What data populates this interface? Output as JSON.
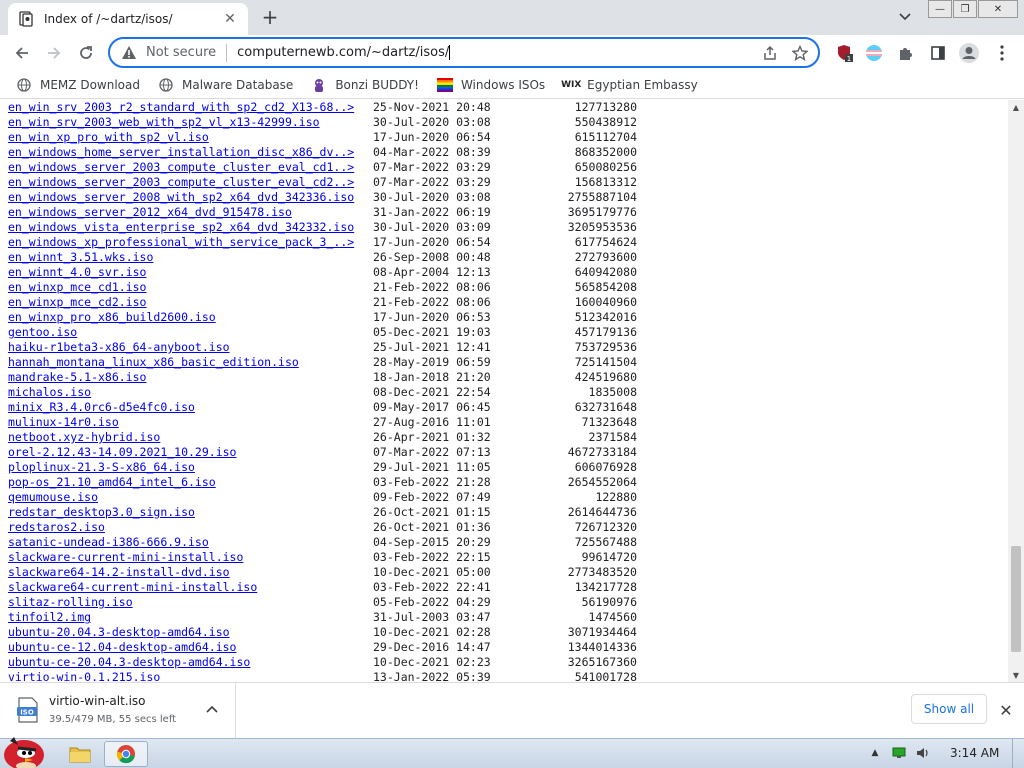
{
  "tab": {
    "title": "Index of /~dartz/isos/",
    "close": "✕"
  },
  "new_tab": "+",
  "window": {
    "minimize": "—",
    "maximize": "❐",
    "close": "✕"
  },
  "omnibox": {
    "security_label": "Not secure",
    "url": "computernewb.com/~dartz/isos/"
  },
  "extensions": {
    "badge": "1"
  },
  "bookmarks": [
    {
      "label": "MEMZ Download",
      "icon": "globe-icon"
    },
    {
      "label": "Malware Database",
      "icon": "globe-icon"
    },
    {
      "label": "Bonzi BUDDY!",
      "icon": "bonzi-icon"
    },
    {
      "label": "Windows ISOs",
      "icon": "windows-flag-icon"
    },
    {
      "label": "Egyptian Embassy",
      "icon": "wix-icon"
    }
  ],
  "listing": [
    {
      "name": "en_win_srv_2003_r2_standard_with_sp2_cd2_X13-68..>",
      "date": "25-Nov-2021 20:48",
      "size": "127713280"
    },
    {
      "name": "en_win_srv_2003_web_with_sp2_vl_x13-42999.iso",
      "date": "30-Jul-2020 03:08",
      "size": "550438912"
    },
    {
      "name": "en_win_xp_pro_with_sp2_vl.iso",
      "date": "17-Jun-2020 06:54",
      "size": "615112704"
    },
    {
      "name": "en_windows_home_server_installation_disc_x86_dv..>",
      "date": "04-Mar-2022 08:39",
      "size": "868352000"
    },
    {
      "name": "en_windows_server_2003_compute_cluster_eval_cd1..>",
      "date": "07-Mar-2022 03:29",
      "size": "650080256"
    },
    {
      "name": "en_windows_server_2003_compute_cluster_eval_cd2..>",
      "date": "07-Mar-2022 03:29",
      "size": "156813312"
    },
    {
      "name": "en_windows_server_2008_with_sp2_x64_dvd_342336.iso",
      "date": "30-Jul-2020 03:08",
      "size": "2755887104"
    },
    {
      "name": "en_windows_server_2012_x64_dvd_915478.iso",
      "date": "31-Jan-2022 06:19",
      "size": "3695179776"
    },
    {
      "name": "en_windows_vista_enterprise_sp2_x64_dvd_342332.iso",
      "date": "30-Jul-2020 03:09",
      "size": "3205953536"
    },
    {
      "name": "en_windows_xp_professional_with_service_pack_3_..>",
      "date": "17-Jun-2020 06:54",
      "size": "617754624"
    },
    {
      "name": "en_winnt_3.51.wks.iso",
      "date": "26-Sep-2008 00:48",
      "size": "272793600"
    },
    {
      "name": "en_winnt_4.0_svr.iso",
      "date": "08-Apr-2004 12:13",
      "size": "640942080"
    },
    {
      "name": "en_winxp_mce_cd1.iso",
      "date": "21-Feb-2022 08:06",
      "size": "565854208"
    },
    {
      "name": "en_winxp_mce_cd2.iso",
      "date": "21-Feb-2022 08:06",
      "size": "160040960"
    },
    {
      "name": "en_winxp_pro_x86_build2600.iso",
      "date": "17-Jun-2020 06:53",
      "size": "512342016"
    },
    {
      "name": "gentoo.iso",
      "date": "05-Dec-2021 19:03",
      "size": "457179136"
    },
    {
      "name": "haiku-r1beta3-x86_64-anyboot.iso",
      "date": "25-Jul-2021 12:41",
      "size": "753729536"
    },
    {
      "name": "hannah_montana_linux_x86_basic_edition.iso",
      "date": "28-May-2019 06:59",
      "size": "725141504"
    },
    {
      "name": "mandrake-5.1-x86.iso",
      "date": "18-Jan-2018 21:20",
      "size": "424519680"
    },
    {
      "name": "michalos.iso",
      "date": "08-Dec-2021 22:54",
      "size": "1835008"
    },
    {
      "name": "minix_R3.4.0rc6-d5e4fc0.iso",
      "date": "09-May-2017 06:45",
      "size": "632731648"
    },
    {
      "name": "mulinux-14r0.iso",
      "date": "27-Aug-2016 11:01",
      "size": "71323648"
    },
    {
      "name": "netboot.xyz-hybrid.iso",
      "date": "26-Apr-2021 01:32",
      "size": "2371584"
    },
    {
      "name": "orel-2.12.43-14.09.2021_10.29.iso",
      "date": "07-Mar-2022 07:13",
      "size": "4672733184"
    },
    {
      "name": "ploplinux-21.3-S-x86_64.iso",
      "date": "29-Jul-2021 11:05",
      "size": "606076928"
    },
    {
      "name": "pop-os_21.10_amd64_intel_6.iso",
      "date": "03-Feb-2022 21:28",
      "size": "2654552064"
    },
    {
      "name": "qemumouse.iso",
      "date": "09-Feb-2022 07:49",
      "size": "122880"
    },
    {
      "name": "redstar_desktop3.0_sign.iso",
      "date": "26-Oct-2021 01:15",
      "size": "2614644736"
    },
    {
      "name": "redstaros2.iso",
      "date": "26-Oct-2021 01:36",
      "size": "726712320"
    },
    {
      "name": "satanic-undead-i386-666.9.iso",
      "date": "04-Sep-2015 20:29",
      "size": "725567488"
    },
    {
      "name": "slackware-current-mini-install.iso",
      "date": "03-Feb-2022 22:15",
      "size": "99614720"
    },
    {
      "name": "slackware64-14.2-install-dvd.iso",
      "date": "10-Dec-2021 05:00",
      "size": "2773483520"
    },
    {
      "name": "slackware64-current-mini-install.iso",
      "date": "03-Feb-2022 22:41",
      "size": "134217728"
    },
    {
      "name": "slitaz-rolling.iso",
      "date": "05-Feb-2022 04:29",
      "size": "56190976"
    },
    {
      "name": "tinfoil2.img",
      "date": "31-Jul-2003 03:47",
      "size": "1474560"
    },
    {
      "name": "ubuntu-20.04.3-desktop-amd64.iso",
      "date": "10-Dec-2021 02:28",
      "size": "3071934464"
    },
    {
      "name": "ubuntu-ce-12.04-desktop-amd64.iso",
      "date": "29-Dec-2016 14:47",
      "size": "1344014336"
    },
    {
      "name": "ubuntu-ce-20.04.3-desktop-amd64.iso",
      "date": "10-Dec-2021 02:23",
      "size": "3265167360"
    },
    {
      "name": "virtio-win-0.1.215.iso",
      "date": "13-Jan-2022 05:39",
      "size": "541001728"
    }
  ],
  "download": {
    "filename": "virtio-win-alt.iso",
    "icon_label": "ISO",
    "status": "39.5/479 MB, 55 secs left",
    "show_all": "Show all",
    "close": "✕"
  },
  "taskbar": {
    "clock": "3:14 AM"
  },
  "colors": {
    "link": "#0000ee",
    "accent": "#1a73e8",
    "tab_strip": "#dee1e6"
  }
}
